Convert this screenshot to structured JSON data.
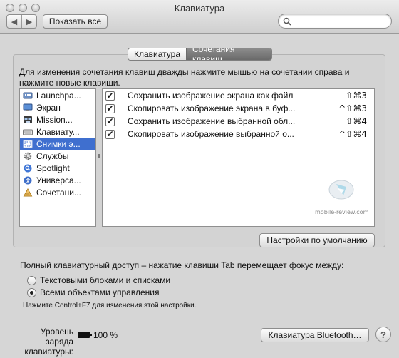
{
  "window": {
    "title": "Клавиатура",
    "traffic_lights": [
      "close",
      "minimize",
      "zoom"
    ]
  },
  "toolbar": {
    "back_icon": "chevron-left-icon",
    "back_glyph": "◀",
    "forward_icon": "chevron-right-icon",
    "forward_glyph": "▶",
    "show_all_label": "Показать все",
    "search_placeholder": "",
    "search_icon": "magnifier-icon"
  },
  "tabs": [
    {
      "label": "Клавиатура",
      "active": false
    },
    {
      "label": "Сочетания клавиш",
      "active": true
    }
  ],
  "instructions": "Для изменения сочетания клавиш дважды нажмите мышью на сочетании справа и нажмите новые клавиши.",
  "categories": [
    {
      "label": "Launchpa...",
      "icon": "launchpad-icon",
      "selected": false
    },
    {
      "label": "Экран",
      "icon": "display-icon",
      "selected": false
    },
    {
      "label": "Mission...",
      "icon": "mission-control-icon",
      "selected": false
    },
    {
      "label": "Клавиату...",
      "icon": "keyboard-icon",
      "selected": false
    },
    {
      "label": "Снимки э...",
      "icon": "screenshot-icon",
      "selected": true
    },
    {
      "label": "Службы",
      "icon": "services-gear-icon",
      "selected": false
    },
    {
      "label": "Spotlight",
      "icon": "spotlight-icon",
      "selected": false
    },
    {
      "label": "Универса...",
      "icon": "accessibility-icon",
      "selected": false
    },
    {
      "label": "Сочетани...",
      "icon": "app-shortcuts-icon",
      "selected": false
    }
  ],
  "shortcuts": [
    {
      "checked": true,
      "check_glyph": "✔",
      "label": "Сохранить изображение экрана как файл",
      "keys": "⇧⌘3"
    },
    {
      "checked": true,
      "check_glyph": "✔",
      "label": "Скопировать изображение экрана в буф...",
      "keys": "^⇧⌘3"
    },
    {
      "checked": true,
      "check_glyph": "✔",
      "label": "Сохранить изображение выбранной обл...",
      "keys": "⇧⌘4"
    },
    {
      "checked": true,
      "check_glyph": "✔",
      "label": "Скопировать изображение выбранной о...",
      "keys": "^⇧⌘4"
    }
  ],
  "watermark": {
    "text": "mobile-review.com",
    "icon": "mobile-review-logo"
  },
  "restore_defaults_label": "Настройки по умолчанию",
  "full_access": {
    "label": "Полный клавиатурный доступ – нажатие клавиши Tab перемещает фокус между:",
    "options": [
      {
        "label": "Текстовыми блоками и списками",
        "selected": false
      },
      {
        "label": "Всеми объектами управления",
        "selected": true
      }
    ],
    "hint": "Нажмите Control+F7 для изменения этой настройки."
  },
  "battery": {
    "label_line1": "Уровень заряда",
    "label_line2": "клавиатуры:",
    "percent": 100,
    "value_text": "100 %",
    "icon": "battery-icon"
  },
  "bluetooth_button_label": "Клавиатура Bluetooth…",
  "help": {
    "glyph": "?",
    "icon": "help-icon"
  }
}
